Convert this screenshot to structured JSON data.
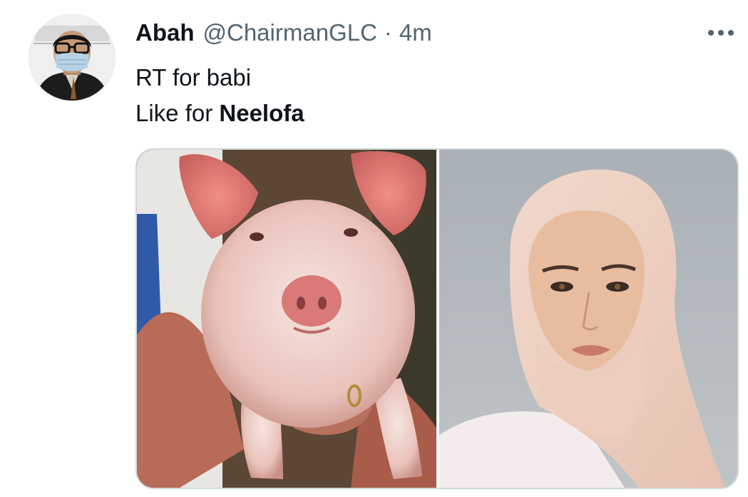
{
  "tweet": {
    "display_name": "Abah",
    "handle": "@ChairmanGLC",
    "separator": "·",
    "time": "4m",
    "text": {
      "line1": "RT for babi",
      "line2_prefix": "Like for ",
      "line2_bold": "Neelofa"
    },
    "more_icon": "more-horizontal-icon",
    "avatar_icon": "user-avatar"
  },
  "media": {
    "images": [
      {
        "name": "pig-photo"
      },
      {
        "name": "woman-hijab-photo"
      }
    ]
  },
  "colors": {
    "text_primary": "#0f1419",
    "text_secondary": "#536471",
    "border": "#cfd9de"
  }
}
